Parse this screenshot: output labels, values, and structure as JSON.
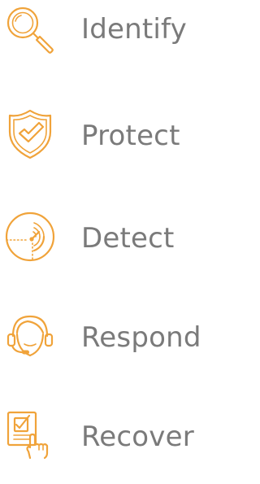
{
  "accent_color": "#f0a33a",
  "text_color": "#7a7a7a",
  "items": [
    {
      "label": "Identify",
      "icon": "magnifier-icon"
    },
    {
      "label": "Protect",
      "icon": "shield-check-icon"
    },
    {
      "label": "Detect",
      "icon": "radar-icon"
    },
    {
      "label": "Respond",
      "icon": "headset-agent-icon"
    },
    {
      "label": "Recover",
      "icon": "checklist-touch-icon"
    }
  ]
}
